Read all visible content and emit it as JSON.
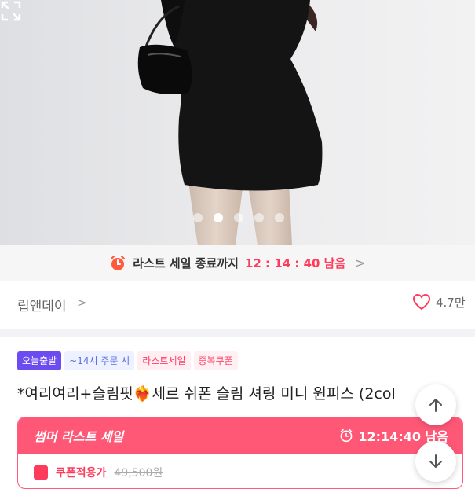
{
  "hero": {
    "image_alt": "model wearing black mini dress holding black bag",
    "slide_count": 5,
    "active_slide": 2
  },
  "timer_strip": {
    "label": "라스트 세일 종료까지",
    "time": "12 : 14 : 40 남음",
    "chevron": ">"
  },
  "store": {
    "name": "립앤데이",
    "chevron": ">",
    "likes": "4.7만"
  },
  "badges": [
    "오늘출발",
    "~14시 주문 시",
    "라스트세일",
    "중복쿠폰"
  ],
  "product": {
    "title": "*여리여리+슬림핏❤️‍🔥세르 쉬폰 슬림 셔링 미니 원피스 (2col"
  },
  "sale_box": {
    "title": "썸머 라스트 세일",
    "timer": "12:14:40 남음",
    "coupon_label": "쿠폰적용가",
    "coupon_price": "49,500원"
  },
  "colors": {
    "accent": "#ff3b5c",
    "badge_purple": "#6c4bf0",
    "sale_header": "#ff5877"
  },
  "icons": [
    "alarm-clock-icon",
    "expand-icon",
    "heart-icon",
    "arrow-up-icon",
    "arrow-down-icon"
  ]
}
